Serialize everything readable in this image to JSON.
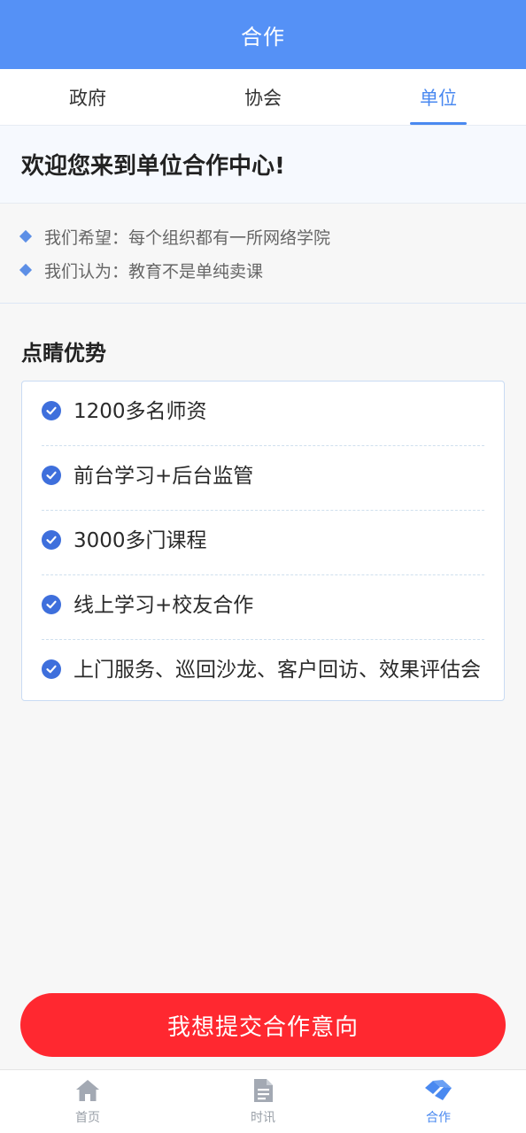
{
  "header": {
    "title": "合作"
  },
  "tabs": [
    {
      "label": "政府",
      "active": false
    },
    {
      "label": "协会",
      "active": false
    },
    {
      "label": "单位",
      "active": true
    }
  ],
  "welcome": {
    "text": "欢迎您来到单位合作中心!"
  },
  "intro": {
    "items": [
      "我们希望：每个组织都有一所网络学院",
      "我们认为：教育不是单纯卖课"
    ]
  },
  "advantages": {
    "title": "点睛优势",
    "items": [
      "1200多名师资",
      "前台学习+后台监管",
      "3000多门课程",
      "线上学习+校友合作",
      "上门服务、巡回沙龙、客户回访、效果评估会"
    ]
  },
  "submit": {
    "label": "我想提交合作意向"
  },
  "bottom_nav": [
    {
      "label": "首页",
      "icon": "home-icon",
      "active": false
    },
    {
      "label": "时讯",
      "icon": "document-icon",
      "active": false
    },
    {
      "label": "合作",
      "icon": "handshake-icon",
      "active": true
    }
  ],
  "colors": {
    "primary": "#5591f6",
    "accent": "#4a89f0",
    "button": "#ff2830",
    "check": "#3e6fdc"
  }
}
